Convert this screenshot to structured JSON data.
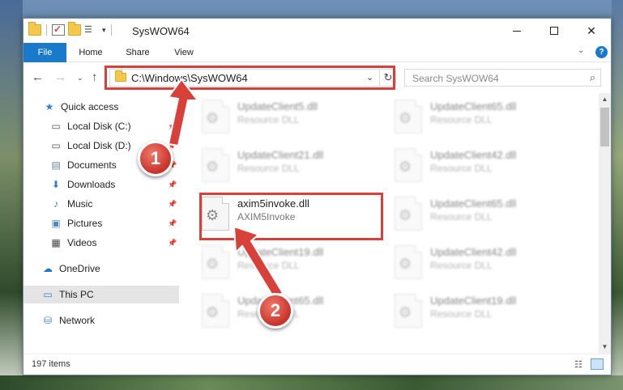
{
  "window": {
    "title": "SysWOW64",
    "min_label": "",
    "close_label": "✕"
  },
  "ribbon": {
    "tabs": [
      "File",
      "Home",
      "Share",
      "View"
    ],
    "expand_glyph": "⌄",
    "help_glyph": "?"
  },
  "address": {
    "path": "C:\\Windows\\SysWOW64",
    "dropdown_glyph": "⌄",
    "refresh_glyph": "↻"
  },
  "search": {
    "placeholder": "Search SysWOW64"
  },
  "nav": {
    "back_glyph": "←",
    "forward_glyph": "→",
    "recent_glyph": "⌄",
    "up_glyph": "↑",
    "items": [
      {
        "label": "Quick access",
        "icon": "star-icon"
      },
      {
        "label": "Local Disk (C:)",
        "icon": "drive-icon"
      },
      {
        "label": "Local Disk (D:)",
        "icon": "drive-icon"
      },
      {
        "label": "Documents",
        "icon": "documents-icon"
      },
      {
        "label": "Downloads",
        "icon": "download-arrow-icon"
      },
      {
        "label": "Music",
        "icon": "music-note-icon"
      },
      {
        "label": "Pictures",
        "icon": "pictures-icon"
      },
      {
        "label": "Videos",
        "icon": "film-icon"
      },
      {
        "label": "OneDrive",
        "icon": "cloud-icon"
      },
      {
        "label": "This PC",
        "icon": "monitor-icon"
      },
      {
        "label": "Network",
        "icon": "network-icon"
      }
    ]
  },
  "files": {
    "left_column": [
      {
        "name": "UpdateClient5.dll",
        "desc": "Resource DLL"
      },
      {
        "name": "UpdateClient21.dll",
        "desc": "Resource DLL"
      },
      {
        "name": "axim5invoke.dll",
        "desc": "AXIM5Invoke"
      },
      {
        "name": "UpdateClient19.dll",
        "desc": "Resource DLL"
      },
      {
        "name": "UpdateClient65.dll",
        "desc": "Resource DLL"
      }
    ],
    "right_column": [
      {
        "name": "UpdateClient65.dll",
        "desc": "Resource DLL"
      },
      {
        "name": "UpdateClient42.dll",
        "desc": "Resource DLL"
      },
      {
        "name": "UpdateClient65.dll",
        "desc": "Resource DLL"
      },
      {
        "name": "UpdateClient42.dll",
        "desc": "Resource DLL"
      },
      {
        "name": "UpdateClient19.dll",
        "desc": "Resource DLL"
      }
    ]
  },
  "status": {
    "item_count": "197 items"
  },
  "annotations": {
    "step1": "1",
    "step2": "2",
    "color": "#d9403a"
  },
  "colors": {
    "accent": "#1979ca",
    "selection": "#cce8ff"
  }
}
